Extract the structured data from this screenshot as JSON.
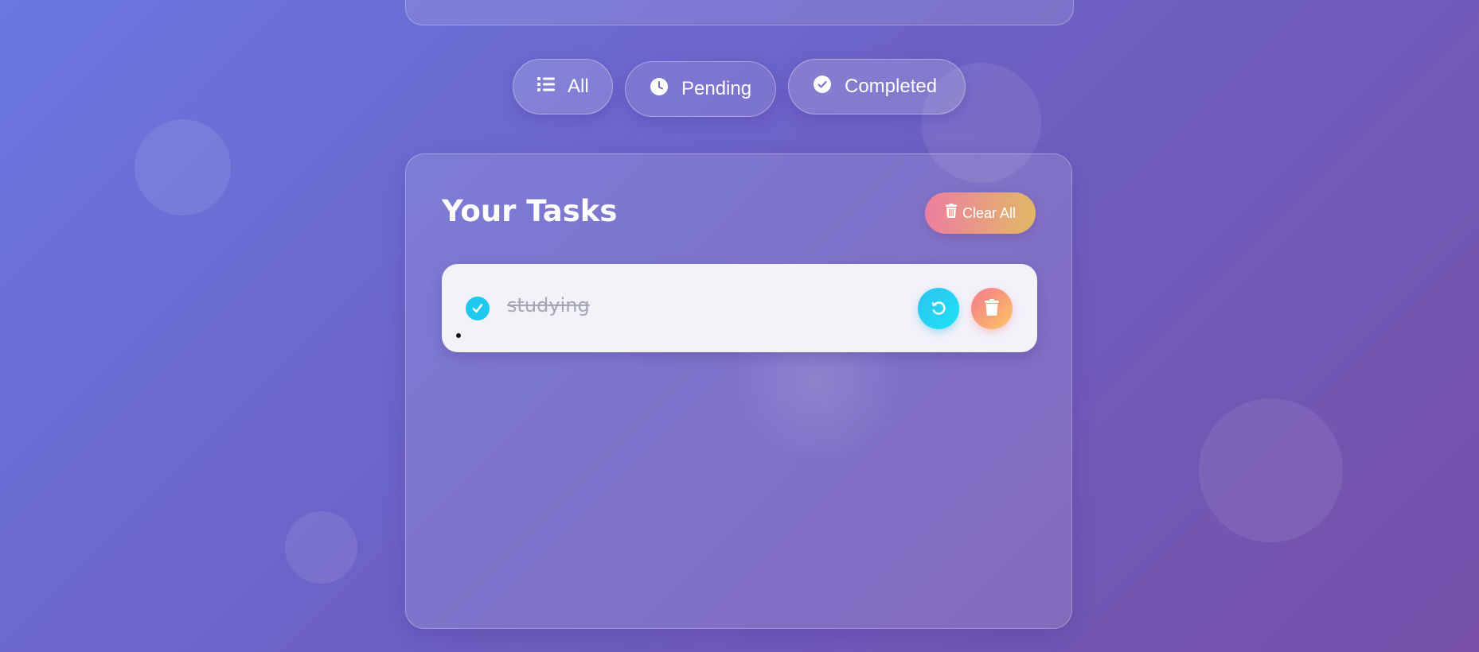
{
  "filters": {
    "all": {
      "label": "All",
      "icon": "list-icon"
    },
    "pending": {
      "label": "Pending",
      "icon": "clock-icon"
    },
    "completed": {
      "label": "Completed",
      "icon": "check-circle-icon"
    }
  },
  "tasks_panel": {
    "title": "Your Tasks",
    "clear_label": "Clear All",
    "clear_icon": "trash-icon"
  },
  "tasks": [
    {
      "text": "studying",
      "completed": true,
      "actions": [
        "undo-icon",
        "trash-icon"
      ]
    }
  ],
  "colors": {
    "background_start": "#6a77e0",
    "background_end": "#7650a8",
    "check_accent": "#1fc8ee",
    "undo_button": "#1de3f2",
    "delete_button_start": "#f4788f",
    "delete_button_end": "#fbc662",
    "clear_button_start": "#ec7ea0",
    "clear_button_end": "#e2b866"
  }
}
